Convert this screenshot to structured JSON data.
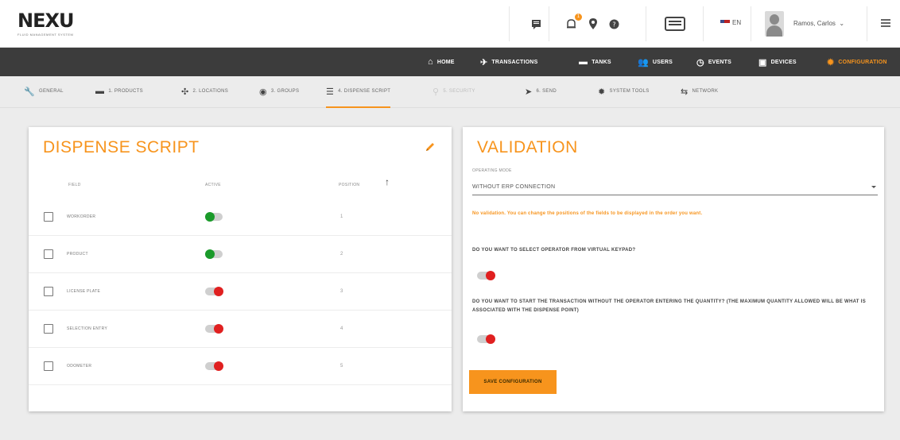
{
  "brand": {
    "logo": "NEXU",
    "logo_sub": "FLUID MANAGEMENT SYSTEM"
  },
  "header": {
    "notification_count": "1",
    "language": "EN",
    "user_name": "Ramos, Carlos"
  },
  "mainnav": {
    "items": [
      {
        "label": "HOME",
        "icon": "home-icon"
      },
      {
        "label": "TRANSACTIONS",
        "icon": "plane-icon"
      },
      {
        "label": "TANKS",
        "icon": "tank-icon"
      },
      {
        "label": "USERS",
        "icon": "users-icon"
      },
      {
        "label": "EVENTS",
        "icon": "alarm-icon"
      },
      {
        "label": "DEVICES",
        "icon": "device-icon"
      },
      {
        "label": "CONFIGURATION",
        "icon": "gear-icon",
        "active": true
      }
    ]
  },
  "subnav": {
    "items": [
      {
        "label": "GENERAL",
        "icon": "wrench-icon"
      },
      {
        "label": "1. PRODUCTS",
        "icon": "products-icon"
      },
      {
        "label": "2. LOCATIONS",
        "icon": "locations-icon"
      },
      {
        "label": "3. GROUPS",
        "icon": "groups-icon"
      },
      {
        "label": "4. DISPENSE SCRIPT",
        "icon": "list-icon",
        "active": true
      },
      {
        "label": "5. SECURITY",
        "icon": "security-icon",
        "disabled": true
      },
      {
        "label": "6. SEND",
        "icon": "send-icon"
      },
      {
        "label": "SYSTEM TOOLS",
        "icon": "tools-icon"
      },
      {
        "label": "NETWORK",
        "icon": "network-icon"
      }
    ]
  },
  "dispense_script": {
    "title": "DISPENSE SCRIPT",
    "columns": {
      "field": "FIELD",
      "active": "ACTIVE",
      "position": "POSITION"
    },
    "rows": [
      {
        "label": "WORKORDER",
        "active": true,
        "position": "1"
      },
      {
        "label": "PRODUCT",
        "active": true,
        "position": "2"
      },
      {
        "label": "LICENSE PLATE",
        "active": false,
        "position": "3"
      },
      {
        "label": "SELECTION ENTRY",
        "active": false,
        "position": "4"
      },
      {
        "label": "ODOMETER",
        "active": false,
        "position": "5"
      }
    ]
  },
  "validation": {
    "title": "VALIDATION",
    "operating_mode_label": "OPERATING MODE",
    "operating_mode_value": "WITHOUT ERP CONNECTION",
    "notice": "No validation. You can change the positions of the fields to be displayed in the order you want.",
    "question1": "DO YOU WANT TO SELECT OPERATOR FROM VIRTUAL KEYPAD?",
    "question1_enabled": false,
    "question2": "DO YOU WANT TO START THE TRANSACTION WITHOUT THE OPERATOR ENTERING THE QUANTITY? (THE MAXIMUM QUANTITY ALLOWED WILL BE WHAT IS ASSOCIATED WITH THE DISPENSE POINT)",
    "question2_enabled": false,
    "save_label": "SAVE CONFIGURATION"
  },
  "colors": {
    "accent": "#f7941d",
    "nav_bg": "#3c3c3c",
    "toggle_on": "#1a9a2a",
    "toggle_off": "#e02020"
  }
}
